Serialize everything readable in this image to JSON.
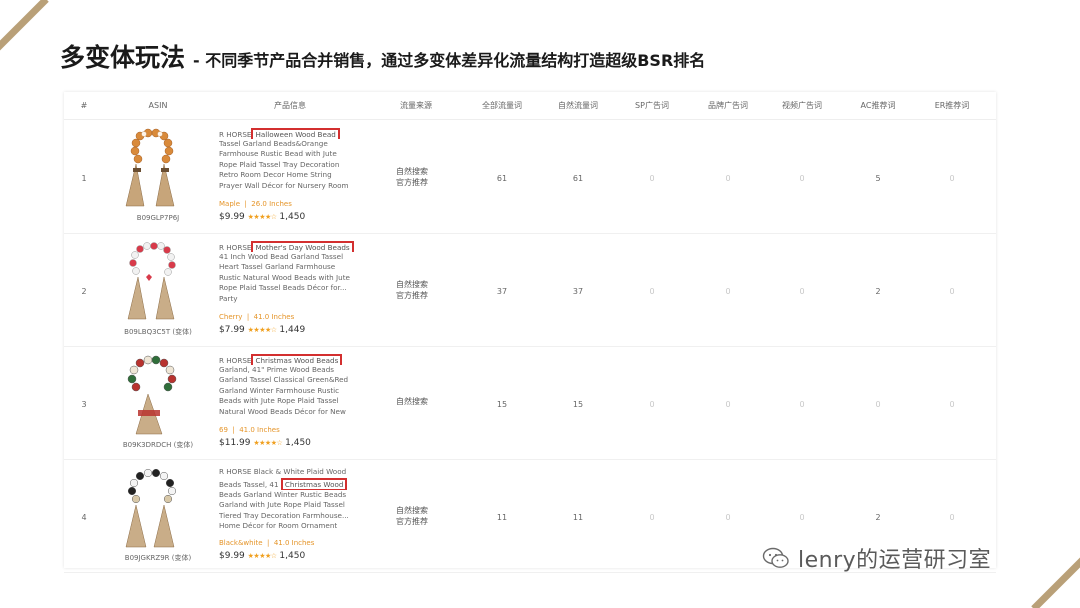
{
  "title": {
    "main": "多变体玩法",
    "sub": "- 不同季节产品合并销售，通过多变体差异化流量结构打造超级BSR排名"
  },
  "table": {
    "headers": [
      "#",
      "ASIN",
      "产品信息",
      "流量来源",
      "全部流量词",
      "自然流量词",
      "SP广告词",
      "品牌广告词",
      "视频广告词",
      "AC推荐词",
      "ER推荐词"
    ],
    "rows": [
      {
        "index": "1",
        "asin": "B09GLP7P6J",
        "brand_prefix": "R HORSE",
        "highlight": "Halloween Wood Bead",
        "lines": [
          "Tassel Garland Beads&Orange",
          "Farmhouse Rustic Bead with Jute",
          "Rope Plaid Tassel Tray Decoration",
          "Retro Room Decor Home String",
          "Prayer Wall Décor for Nursery Room"
        ],
        "variant": "Maple",
        "size": "26.0 Inches",
        "price": "$9.99",
        "stars": "★★★★☆",
        "reviews": "1,450",
        "source": [
          "自然搜索",
          "官方推荐"
        ],
        "all_kw": "61",
        "natural_kw": "61",
        "sp_kw": "0",
        "brand_kw": "0",
        "video_kw": "0",
        "ac_kw": "5",
        "er_kw": "0"
      },
      {
        "index": "2",
        "asin": "B09LBQ3C5T (变体)",
        "brand_prefix": "R HORSE",
        "highlight": "Mother's Day Wood Beads",
        "lines": [
          "41 Inch Wood Bead Garland Tassel",
          "Heart Tassel Garland Farmhouse",
          "Rustic Natural Wood Beads with Jute",
          "Rope Plaid Tassel Beads Décor for...",
          "Party"
        ],
        "variant": "Cherry",
        "size": "41.0 Inches",
        "price": "$7.99",
        "stars": "★★★★☆",
        "reviews": "1,449",
        "source": [
          "自然搜索",
          "官方推荐"
        ],
        "all_kw": "37",
        "natural_kw": "37",
        "sp_kw": "0",
        "brand_kw": "0",
        "video_kw": "0",
        "ac_kw": "2",
        "er_kw": "0"
      },
      {
        "index": "3",
        "asin": "B09K3DRDCH (变体)",
        "brand_prefix": "R HORSE",
        "highlight": "Christmas Wood Beads",
        "lines": [
          "Garland, 41\" Prime Wood Beads",
          "Garland Tassel Classical Green&Red",
          "Garland Winter Farmhouse Rustic",
          "Beads with Jute Rope Plaid Tassel",
          "Natural Wood Beads Décor for New"
        ],
        "variant": "69",
        "size": "41.0 Inches",
        "price": "$11.99",
        "stars": "★★★★☆",
        "reviews": "1,450",
        "source": [
          "自然搜索"
        ],
        "all_kw": "15",
        "natural_kw": "15",
        "sp_kw": "0",
        "brand_kw": "0",
        "video_kw": "0",
        "ac_kw": "0",
        "er_kw": "0"
      },
      {
        "index": "4",
        "asin": "B09JGKRZ9R (变体)",
        "brand_prefix": "R HORSE Black & White Plaid Wood",
        "line_before_highlight": "Beads Tassel, 41",
        "highlight": "Christmas Wood",
        "lines": [
          "Beads Garland Winter Rustic Beads",
          "Garland with Jute Rope Plaid Tassel",
          "Tiered Tray Decoration Farmhouse...",
          "Home Décor for Room Ornament"
        ],
        "variant": "Black&white",
        "size": "41.0 Inches",
        "price": "$9.99",
        "stars": "★★★★☆",
        "reviews": "1,450",
        "source": [
          "自然搜索",
          "官方推荐"
        ],
        "all_kw": "11",
        "natural_kw": "11",
        "sp_kw": "0",
        "brand_kw": "0",
        "video_kw": "0",
        "ac_kw": "2",
        "er_kw": "0"
      }
    ]
  },
  "watermark": {
    "text": "lenry的运营研习室"
  },
  "colors": {
    "accent_gold": "#b9a078",
    "highlight_box": "#d32f2f",
    "variant_orange": "#e5952a",
    "stars": "#f0a020"
  }
}
